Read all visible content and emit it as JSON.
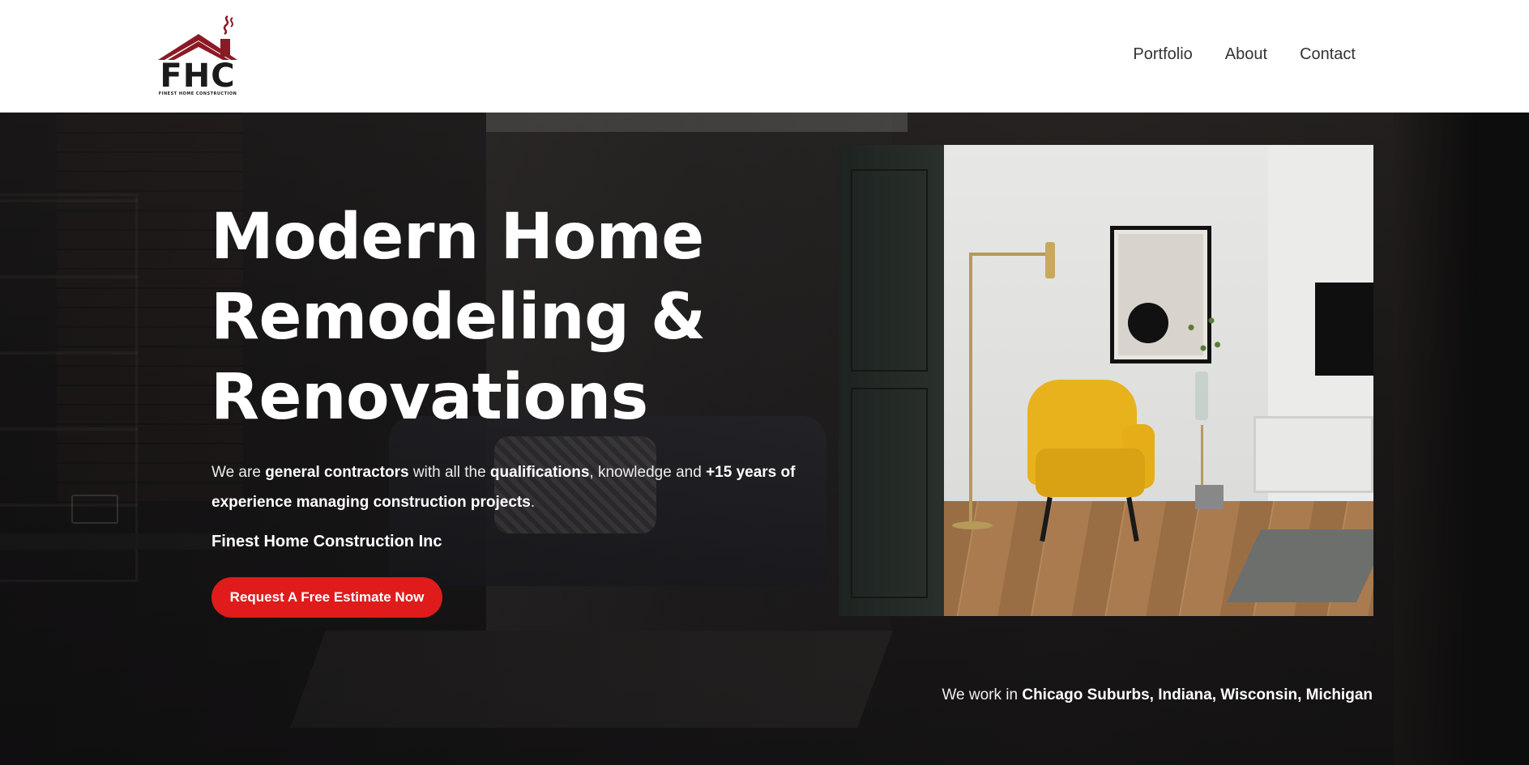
{
  "brand": {
    "logo_text": "FHC",
    "logo_subtext": "FINEST HOME CONSTRUCTION"
  },
  "nav": {
    "items": [
      {
        "label": "Portfolio"
      },
      {
        "label": "About"
      },
      {
        "label": "Contact"
      }
    ]
  },
  "hero": {
    "title_lines": [
      "Modern Home",
      "Remodeling &",
      "Renovations"
    ],
    "desc": {
      "p1": "We are ",
      "b1": "general contractors",
      "p2": " with all the ",
      "b2": "qualifications",
      "p3": ", knowledge and ",
      "b3": "+15 years of experience managing construction projects",
      "p4": "."
    },
    "company": "Finest Home Construction Inc",
    "cta_label": "Request A Free Estimate Now",
    "regions_prefix": "We work in ",
    "regions_list": "Chicago Suburbs, Indiana, Wisconsin, Michigan"
  },
  "colors": {
    "accent": "#e01b1b",
    "logo_roof": "#8b1a24",
    "nav_text": "#333333",
    "hero_text": "#ffffff"
  },
  "icons": {
    "logo": "house-roof-chimney-logo"
  }
}
